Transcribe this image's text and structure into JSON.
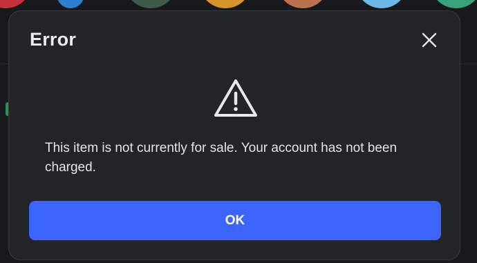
{
  "dialog": {
    "title": "Error",
    "message": "This item is not currently for sale. Your account has not been charged.",
    "ok_label": "OK",
    "close_icon": "close-icon",
    "warning_icon": "warning-triangle-icon"
  },
  "colors": {
    "dialog_bg": "#232428",
    "primary_button": "#3c64ff",
    "text": "#e6e6e8"
  }
}
